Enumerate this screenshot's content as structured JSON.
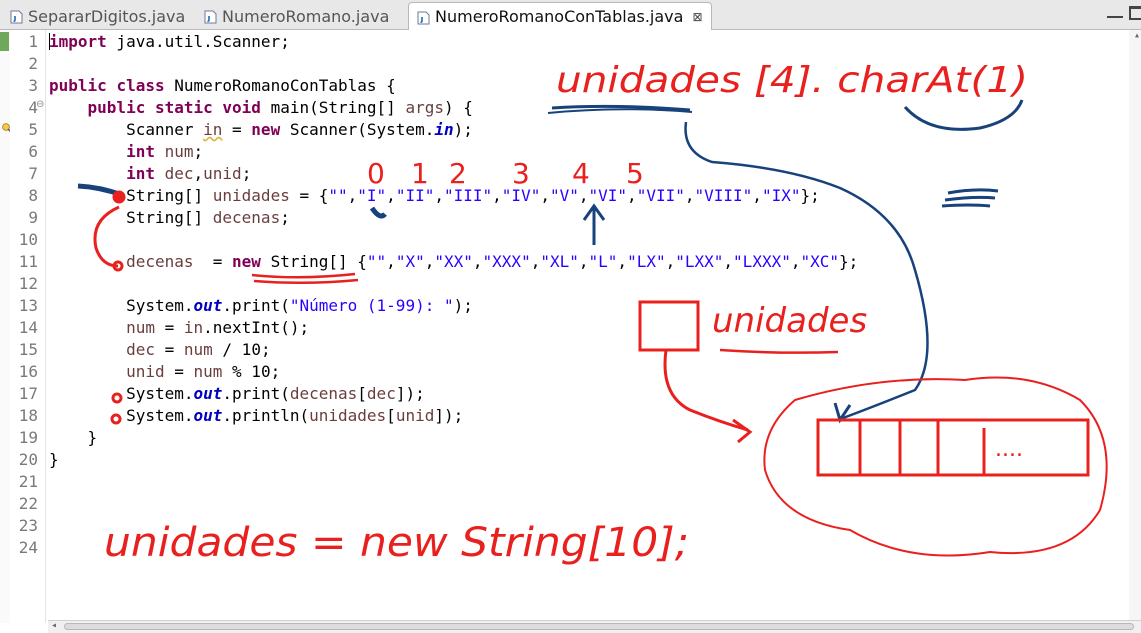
{
  "tabs": [
    {
      "label": "SepararDigitos.java",
      "active": false
    },
    {
      "label": "NumeroRomano.java",
      "active": false
    },
    {
      "label": "NumeroRomanoConTablas.java",
      "active": true
    }
  ],
  "tab_close_glyph": "⊠",
  "line_numbers": [
    "1",
    "2",
    "3",
    "4",
    "5",
    "6",
    "7",
    "8",
    "9",
    "10",
    "11",
    "12",
    "13",
    "14",
    "15",
    "16",
    "17",
    "18",
    "19",
    "20",
    "21",
    "22",
    "23",
    "24"
  ],
  "fold_marker": "⊖",
  "code": {
    "l1": {
      "kw": "import",
      "rest": " java.util.Scanner;"
    },
    "l3": {
      "kw1": "public",
      "kw2": "class",
      "rest": " NumeroRomanoConTablas {"
    },
    "l4": {
      "indent": "    ",
      "kw1": "public",
      "kw2": "static",
      "kw3": "void",
      "mid": " main(String[] ",
      "var": "args",
      "end": ") {"
    },
    "l5": {
      "indent": "        ",
      "t1": "Scanner ",
      "var": "in",
      "t2": " = ",
      "kw": "new",
      "t3": " Scanner(System.",
      "fld": "in",
      "t4": ");"
    },
    "l6": {
      "indent": "        ",
      "kw": "int",
      "t1": " ",
      "var": "num",
      "t2": ";"
    },
    "l7": {
      "indent": "        ",
      "kw": "int",
      "t1": " ",
      "var1": "dec",
      "t2": ",",
      "var2": "unid",
      "t3": ";"
    },
    "l8": {
      "indent": "        ",
      "t1": "String[] ",
      "var": "unidades",
      "t2": " = {",
      "strings": [
        "\"\"",
        "\"I\"",
        "\"II\"",
        "\"III\"",
        "\"IV\"",
        "\"V\"",
        "\"VI\"",
        "\"VII\"",
        "\"VIII\"",
        "\"IX\""
      ],
      "t3": "};"
    },
    "l9": {
      "indent": "        ",
      "t1": "String[] ",
      "var": "decenas",
      "t2": ";"
    },
    "l11": {
      "indent": "        ",
      "var": "decenas",
      "t1": "  = ",
      "kw": "new",
      "t2": " String[] {",
      "strings": [
        "\"\"",
        "\"X\"",
        "\"XX\"",
        "\"XXX\"",
        "\"XL\"",
        "\"L\"",
        "\"LX\"",
        "\"LXX\"",
        "\"LXXX\"",
        "\"XC\""
      ],
      "t3": "};"
    },
    "l13": {
      "indent": "        ",
      "t1": "System.",
      "fld": "out",
      "t2": ".print(",
      "str": "\"Número (1-99): \"",
      "t3": ");"
    },
    "l14": {
      "indent": "        ",
      "var1": "num",
      "t1": " = ",
      "var2": "in",
      "t2": ".nextInt();"
    },
    "l15": {
      "indent": "        ",
      "var1": "dec",
      "t1": " = ",
      "var2": "num",
      "t2": " / 10;"
    },
    "l16": {
      "indent": "        ",
      "var1": "unid",
      "t1": " = ",
      "var2": "num",
      "t2": " % 10;"
    },
    "l17": {
      "indent": "        ",
      "t1": "System.",
      "fld": "out",
      "t2": ".print(",
      "var1": "decenas",
      "t3": "[",
      "var2": "dec",
      "t4": "]);"
    },
    "l18": {
      "indent": "        ",
      "t1": "System.",
      "fld": "out",
      "t2": ".println(",
      "var1": "unidades",
      "t3": "[",
      "var2": "unid",
      "t4": "]);"
    },
    "l19": {
      "indent": "    ",
      "t1": "}"
    },
    "l20": {
      "t1": "}"
    }
  },
  "annotations": {
    "top": "unidades [4]. charAt(1)",
    "indices": [
      "0",
      "1",
      "2",
      "3",
      "4",
      "5"
    ],
    "box_label": "unidades",
    "bottom": "unidades = new String[10];",
    "array_dots": "...."
  },
  "colors": {
    "ink_red": "#e8201e",
    "ink_blue": "#17427c",
    "keyword": "#7f0055",
    "string": "#2a00ff",
    "local_var": "#6a3e3e",
    "static_field": "#0000c0"
  }
}
